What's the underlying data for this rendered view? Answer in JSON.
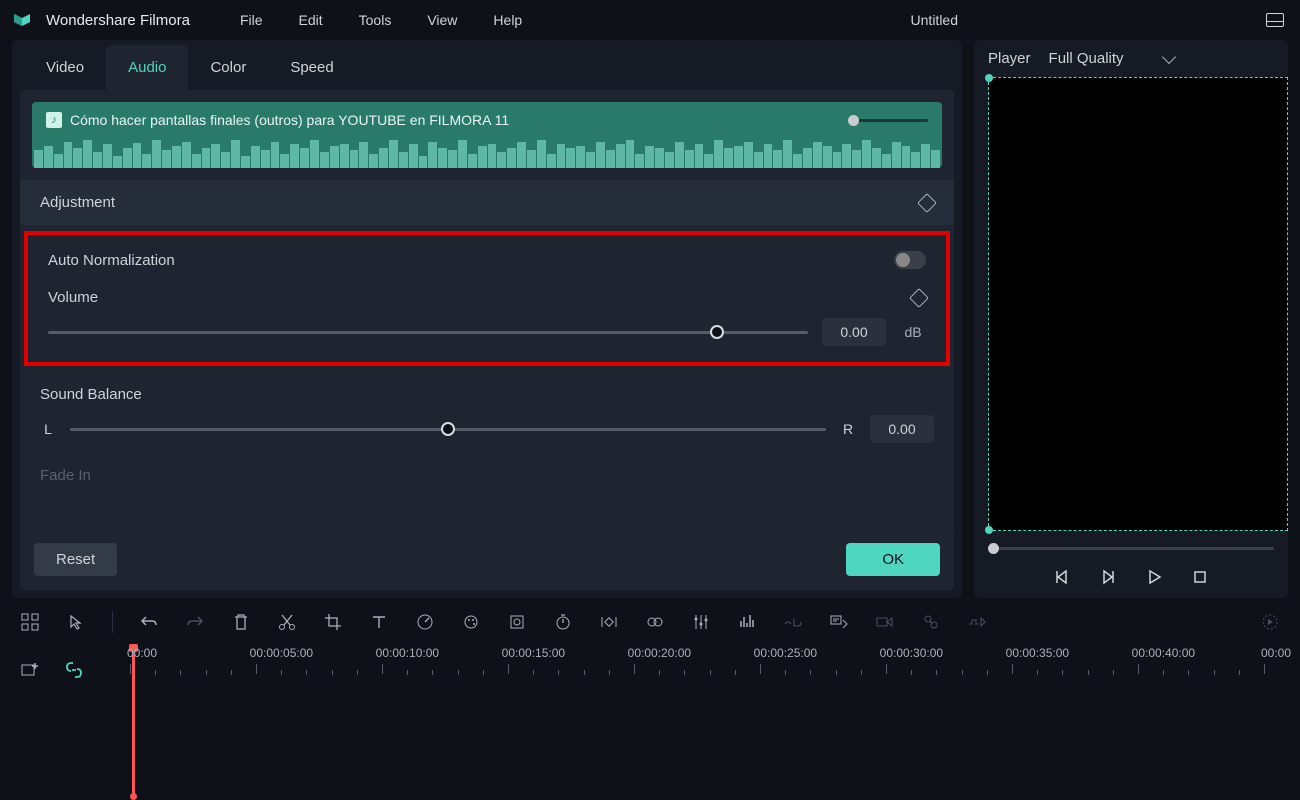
{
  "app": {
    "title": "Wondershare Filmora",
    "document": "Untitled"
  },
  "menu": {
    "file": "File",
    "edit": "Edit",
    "tools": "Tools",
    "view": "View",
    "help": "Help"
  },
  "tabs": {
    "video": "Video",
    "audio": "Audio",
    "color": "Color",
    "speed": "Speed",
    "active": "audio"
  },
  "clip": {
    "title": "Cómo hacer pantallas finales (outros) para YOUTUBE en FILMORA 11"
  },
  "sections": {
    "adjustment": "Adjustment",
    "auto_normalization": "Auto Normalization",
    "volume": "Volume",
    "sound_balance": "Sound Balance",
    "fade_in": "Fade In"
  },
  "values": {
    "volume": "0.00",
    "volume_unit": "dB",
    "balance_left": "L",
    "balance_right": "R",
    "balance": "0.00"
  },
  "buttons": {
    "reset": "Reset",
    "ok": "OK"
  },
  "player": {
    "label": "Player",
    "quality": "Full Quality"
  },
  "timeline": {
    "labels": [
      "00:00",
      "00:00:05:00",
      "00:00:10:00",
      "00:00:15:00",
      "00:00:20:00",
      "00:00:25:00",
      "00:00:30:00",
      "00:00:35:00",
      "00:00:40:00",
      "00:00"
    ]
  }
}
